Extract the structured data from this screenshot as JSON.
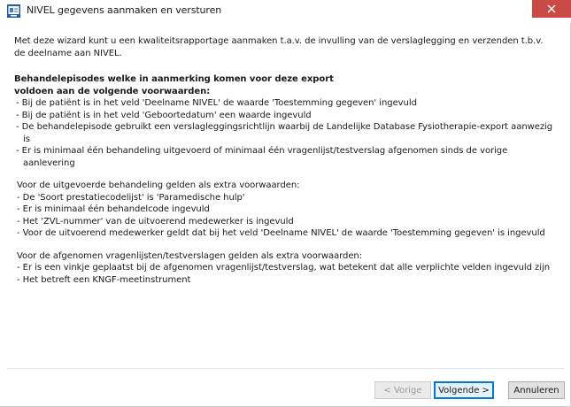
{
  "window": {
    "title": "NIVEL gegevens aanmaken en versturen",
    "accent_color": "#0078d7",
    "close_color": "#c94a44"
  },
  "content": {
    "intro": "Met deze wizard kunt u een kwaliteitsrapportage aanmaken t.a.v. de invulling van de verslaglegging en verzenden t.b.v. de deelname aan NIVEL.",
    "heading_line1": "Behandelepisodes welke in aanmerking komen voor deze export",
    "heading_line2": "voldoen aan de volgende voorwaarden:",
    "requirements": [
      "- Bij de patiënt is in het veld 'Deelname NIVEL' de waarde 'Toestemming gegeven' ingevuld",
      "- Bij de patiënt is in het veld 'Geboortedatum' een waarde ingevuld",
      "- De behandelepisode gebruikt een verslagleggingsrichtlijn waarbij de Landelijke Database Fysiotherapie-export aanwezig is",
      "- Er is minimaal één behandeling uitgevoerd of minimaal één vragenlijst/testverslag afgenomen sinds de vorige aanlevering"
    ],
    "treatment_title": "Voor de uitgevoerde behandeling gelden als extra voorwaarden:",
    "treatment_conditions": [
      "- De 'Soort prestatiecodelijst' is 'Paramedische hulp'",
      "- Er is minimaal één behandelcode ingevuld",
      "- Het 'ZVL-nummer' van de uitvoerend medewerker is ingevuld",
      "- Voor de uitvoerend medewerker geldt dat bij het veld 'Deelname NIVEL' de waarde 'Toestemming gegeven' is ingevuld"
    ],
    "questionnaire_title": "Voor de afgenomen vragenlijsten/testverslagen gelden als extra voorwaarden:",
    "questionnaire_conditions": [
      "- Er is een vinkje geplaatst bij de afgenomen vragenlijst/testverslag, wat betekent dat alle verplichte velden ingevuld zijn",
      "- Het betreft een KNGF-meetinstrument"
    ]
  },
  "buttons": {
    "prev_label": "< Vorige",
    "next_label": "Volgende >",
    "cancel_label": "Annuleren"
  }
}
